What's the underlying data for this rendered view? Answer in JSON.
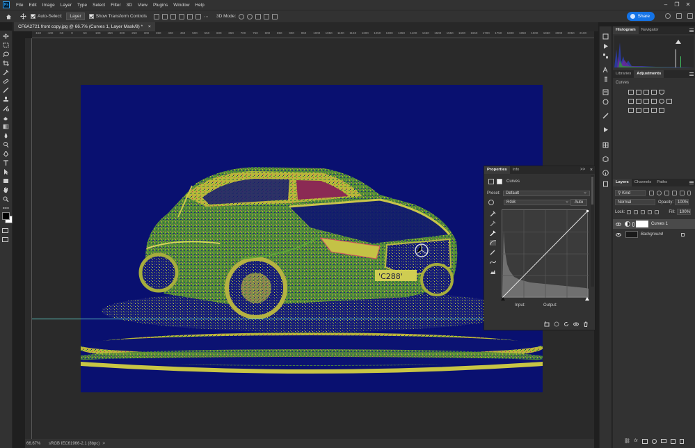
{
  "app": {
    "logo_text": "Ps",
    "menu": [
      "File",
      "Edit",
      "Image",
      "Layer",
      "Type",
      "Select",
      "Filter",
      "3D",
      "View",
      "Plugins",
      "Window",
      "Help"
    ]
  },
  "options": {
    "auto_select_label": "Auto-Select:",
    "auto_select_value": "Layer",
    "transform_label": "Show Transform Controls",
    "mode_3d_label": "3D Mode:",
    "share_label": "Share"
  },
  "document": {
    "tab_title": "CF6A2721 front copy.jpg @ 66.7% (Curves 1, Layer Mask/8) *",
    "close_glyph": "×"
  },
  "rulers": {
    "top_ticks": [
      "-150",
      "-100",
      "-50",
      "0",
      "50",
      "100",
      "150",
      "200",
      "250",
      "300",
      "350",
      "400",
      "450",
      "500",
      "550",
      "600",
      "650",
      "700",
      "750",
      "800",
      "850",
      "900",
      "950",
      "1000",
      "1050",
      "1100",
      "1150",
      "1200",
      "1250",
      "1300",
      "1350",
      "1400",
      "1450",
      "1500",
      "1550",
      "1600",
      "1650",
      "1700",
      "1750",
      "1800",
      "1850",
      "1900",
      "1950",
      "2000",
      "2050",
      "2100"
    ]
  },
  "status": {
    "zoom": "66.67%",
    "profile": "sRGB IEC61966-2.1 (8bpc)",
    "arrow": ">"
  },
  "panels": {
    "histogram_tabs": [
      "Histogram",
      "Navigator"
    ],
    "adjust_tabs": [
      "Libraries",
      "Adjustments"
    ],
    "adjust_subtitle": "Curves",
    "layers_tabs": [
      "Layers",
      "Channels",
      "Paths"
    ],
    "kind_label": "Kind",
    "blend_mode": "Normal",
    "opacity_label": "Opacity:",
    "opacity_value": "100%",
    "lock_label": "Lock:",
    "fill_label": "Fill:",
    "fill_value": "100%",
    "layers": [
      {
        "name": "Curves 1",
        "selected": true
      },
      {
        "name": "Background",
        "italic": true
      }
    ]
  },
  "properties": {
    "tabs": [
      "Properties",
      "Info"
    ],
    "title": "Curves",
    "preset_label": "Preset:",
    "preset_value": "Default",
    "channel_value": "RGB",
    "auto_label": "Auto",
    "input_label": "Input:",
    "output_label": "Output:",
    "collapse_glyph": ">>",
    "close_glyph": "×"
  },
  "colors": {
    "canvas_bg": "#091070",
    "accent": "#1473e6",
    "guide": "#5fc9c4"
  }
}
